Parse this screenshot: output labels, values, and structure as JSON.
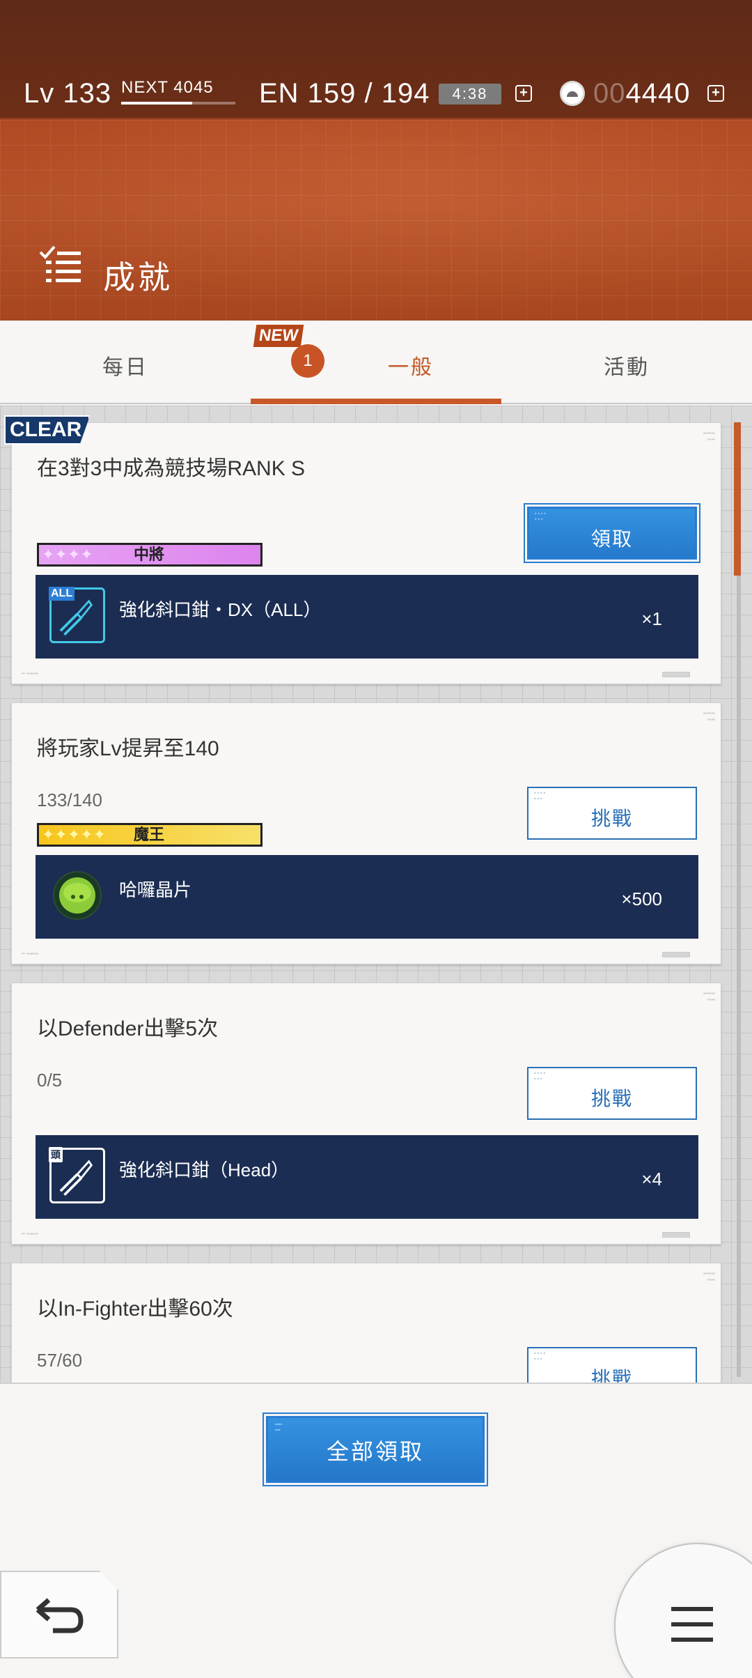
{
  "status": {
    "level": "Lv 133",
    "next": "NEXT 4045",
    "next_progress": 0.62,
    "energy": "EN 159 / 194",
    "timer": "4:38",
    "currency_dim": "00",
    "currency": "4440"
  },
  "page": {
    "title": "成就",
    "icon": "checklist-icon"
  },
  "tabs": [
    {
      "label": "每日",
      "active": false
    },
    {
      "label": "一般",
      "active": true,
      "new_badge": "NEW",
      "count": "1"
    },
    {
      "label": "活動",
      "active": false
    }
  ],
  "clear_label": "CLEAR",
  "achievements": [
    {
      "title": "在3對3中成為競技場RANK S",
      "progress": "",
      "rank": "中將",
      "rank_stars": "✦✦✦✦",
      "button": "領取",
      "button_type": "claim",
      "reward": {
        "tag": "ALL",
        "name": "強化斜口鉗・DX（ALL）",
        "qty": "×1"
      }
    },
    {
      "title": "將玩家Lv提昇至140",
      "progress": "133/140",
      "rank": "魔王",
      "rank_stars": "✦✦✦✦✦",
      "button": "挑戰",
      "button_type": "challenge",
      "reward": {
        "tag": "",
        "name": "哈囉晶片",
        "qty": "×500"
      }
    },
    {
      "title": "以Defender出擊5次",
      "progress": "0/5",
      "rank": "",
      "button": "挑戰",
      "button_type": "challenge",
      "reward": {
        "tag": "頭",
        "name": "強化斜口鉗（Head）",
        "qty": "×4"
      }
    },
    {
      "title": "以In-Fighter出擊60次",
      "progress": "57/60",
      "button": "挑戰",
      "button_type": "challenge"
    }
  ],
  "bottom": {
    "claim_all": "全部領取"
  },
  "colors": {
    "accent": "#c8582a",
    "claim_blue": "#2a7bd1",
    "reward_bg": "#1b2d52"
  }
}
